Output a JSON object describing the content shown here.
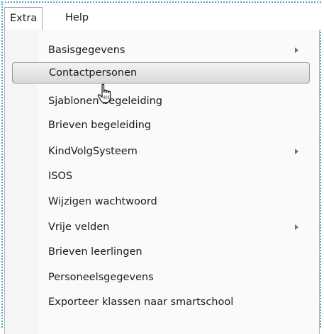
{
  "menubar": {
    "items": [
      {
        "label": "Extra"
      },
      {
        "label": "Help"
      }
    ]
  },
  "dropdown": {
    "items": [
      {
        "label": "Basisgegevens",
        "submenu": true
      },
      {
        "label": "Contactpersonen",
        "submenu": false,
        "highlighted": true
      },
      {
        "label": "Sjablonen begeleiding",
        "submenu": false
      },
      {
        "label": "Brieven begeleiding",
        "submenu": false
      },
      {
        "label": "KindVolgSysteem",
        "submenu": true
      },
      {
        "label": "ISOS",
        "submenu": false
      },
      {
        "label": "Wijzigen wachtwoord",
        "submenu": false
      },
      {
        "label": "Vrije velden",
        "submenu": true
      },
      {
        "label": "Brieven leerlingen",
        "submenu": false
      },
      {
        "label": "Personeelsgegevens",
        "submenu": false
      },
      {
        "label": "Exporteer klassen naar smartschool",
        "submenu": false
      }
    ]
  },
  "icons": {
    "submenu_arrow": "chevron-right-icon",
    "cursor": "hand-pointer-icon"
  },
  "colors": {
    "frame_border": "#4aa8c0",
    "highlight_border": "#9a9a9a"
  }
}
